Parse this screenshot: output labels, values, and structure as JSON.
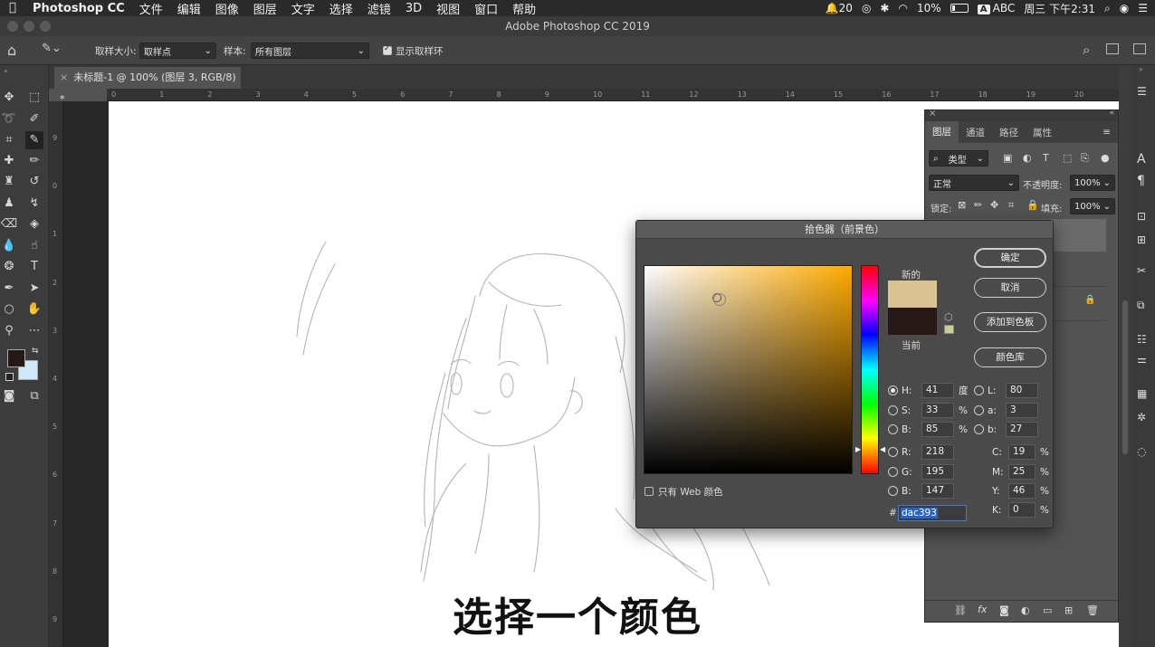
{
  "menubar": {
    "app": "Photoshop CC",
    "items": [
      "文件",
      "编辑",
      "图像",
      "图层",
      "文字",
      "选择",
      "滤镜",
      "3D",
      "视图",
      "窗口",
      "帮助"
    ],
    "status": {
      "notifications": "20",
      "battery": "10%",
      "input": "ABC",
      "datetime": "周三 下午2:31"
    }
  },
  "window": {
    "title": "Adobe Photoshop CC 2019"
  },
  "options": {
    "sample_size_label": "取样大小:",
    "sample_size_value": "取样点",
    "sample_label": "样本:",
    "sample_value": "所有图层",
    "show_ring_label": "显示取样环",
    "show_ring_checked": true
  },
  "document": {
    "tab_title": "未标题-1 @ 100% (图层 3, RGB/8) *"
  },
  "ruler": {
    "h_labels": [
      "0",
      "1",
      "2",
      "3",
      "4",
      "5",
      "6",
      "7",
      "8",
      "9",
      "10",
      "11",
      "12",
      "13",
      "14",
      "15",
      "16",
      "17",
      "18",
      "19",
      "20"
    ],
    "v_labels": [
      "9",
      "0",
      "1",
      "2",
      "3",
      "4",
      "5",
      "6",
      "7",
      "8",
      "9"
    ]
  },
  "layers_panel": {
    "tabs": [
      "图层",
      "通道",
      "路径",
      "属性"
    ],
    "filter_kind": "类型",
    "blend_mode": "正常",
    "opacity_label": "不透明度:",
    "opacity_value": "100%",
    "lock_label": "锁定:",
    "fill_label": "填充:",
    "fill_value": "100%"
  },
  "picker": {
    "title": "拾色器（前景色）",
    "new_label": "新的",
    "current_label": "当前",
    "new_color": "#dac393",
    "current_color": "#261814",
    "buttons": {
      "ok": "确定",
      "cancel": "取消",
      "add_swatch": "添加到色板",
      "libraries": "颜色库"
    },
    "web_only_label": "只有 Web 颜色",
    "hsb": {
      "h": "41",
      "s": "33",
      "b": "85"
    },
    "rgb": {
      "r": "218",
      "g": "195",
      "b": "147"
    },
    "lab": {
      "l": "80",
      "a": "3",
      "b": "27"
    },
    "cmyk": {
      "c": "19",
      "m": "25",
      "y": "46",
      "k": "0"
    },
    "units": {
      "degree": "度",
      "percent": "%"
    },
    "hex_prefix": "#",
    "hex": "dac393"
  },
  "subtitle": "选择一个颜色"
}
